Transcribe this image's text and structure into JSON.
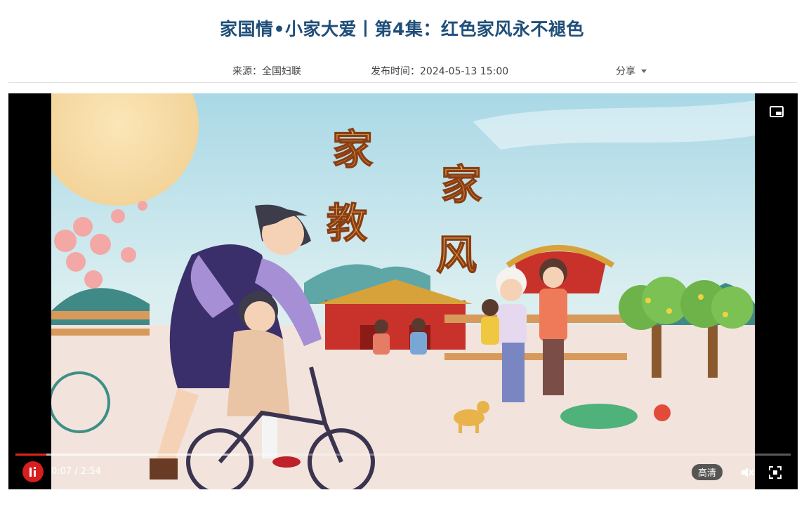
{
  "article": {
    "title": "家国情•小家大爱丨第4集：红色家风永不褪色",
    "source": "来源：全国妇联",
    "publish_time": "发布时间：2024-05-13 15:00",
    "share_label": "分享"
  },
  "player": {
    "artwork_chars": [
      "家",
      "教",
      "家",
      "风"
    ],
    "time_display": "0:07 / 2:54",
    "progress": 0.04,
    "buffered": 0.29,
    "quality_label": "高清",
    "icons": {
      "pip": "picture-in-picture-icon",
      "logo": "player-logo-icon",
      "mute": "muted-speaker-icon",
      "fullscreen": "fullscreen-icon"
    }
  },
  "colors": {
    "title": "#1f4e79",
    "progress": "#e0241b",
    "logo": "#d81e1e"
  }
}
